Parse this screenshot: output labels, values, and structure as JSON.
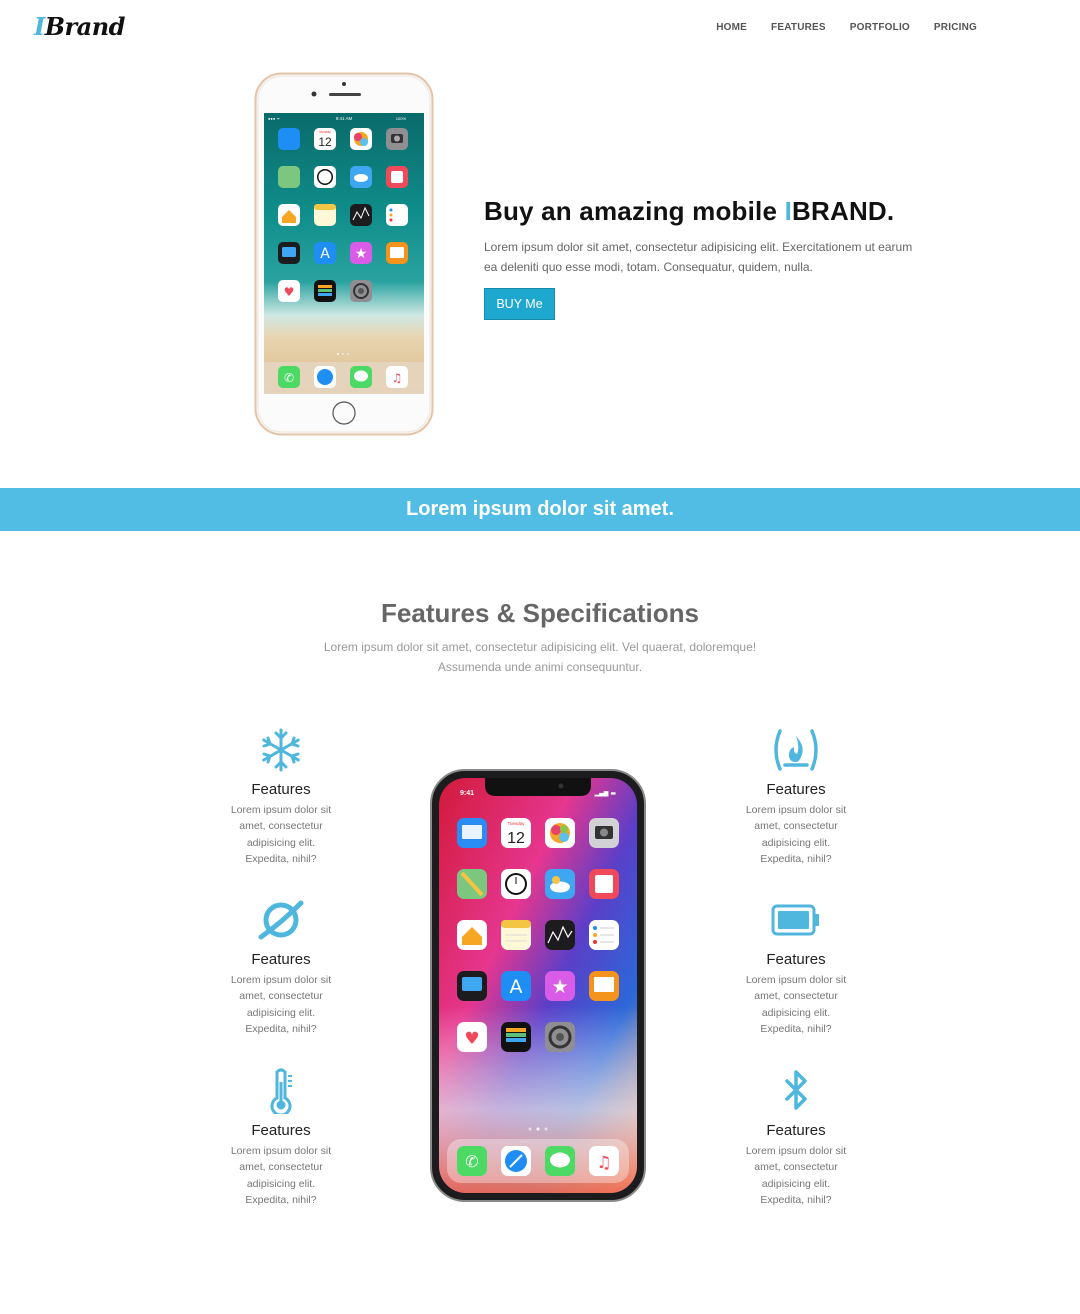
{
  "brand": {
    "prefix": "I",
    "name": "Brand"
  },
  "nav": {
    "items": [
      {
        "label": "HOME"
      },
      {
        "label": "FEATURES"
      },
      {
        "label": "PORTFOLIO"
      },
      {
        "label": "PRICING"
      }
    ]
  },
  "hero": {
    "title_before": "Buy an amazing mobile ",
    "title_accent": "I",
    "title_after": "BRAND.",
    "description": "Lorem ipsum dolor sit amet, consectetur adipisicing elit. Exercitationem ut earum ea deleniti quo esse modi, totam. Consequatur, quidem, nulla.",
    "button_label": "BUY Me",
    "phone": {
      "status_time": "9:41 AM",
      "status_battery": "100%",
      "calendar_day": "Monday",
      "calendar_date": "12"
    }
  },
  "banner": {
    "text": "Lorem ipsum dolor sit amet."
  },
  "features_section": {
    "title": "Features & Specifications",
    "subtitle": "Lorem ipsum dolor sit amet, consectetur adipisicing elit. Vel quaerat, doloremque! Assumenda unde animi consequuntur.",
    "left": [
      {
        "icon": "snowflake-icon",
        "name": "Features",
        "desc": "Lorem ipsum dolor sit amet, consectetur adipisicing elit. Expedita, nihil?"
      },
      {
        "icon": "planet-ring-icon",
        "name": "Features",
        "desc": "Lorem ipsum dolor sit amet, consectetur adipisicing elit. Expedita, nihil?"
      },
      {
        "icon": "thermometer-icon",
        "name": "Features",
        "desc": "Lorem ipsum dolor sit amet, consectetur adipisicing elit. Expedita, nihil?"
      }
    ],
    "right": [
      {
        "icon": "fire-icon",
        "name": "Features",
        "desc": "Lorem ipsum dolor sit amet, consectetur adipisicing elit. Expedita, nihil?"
      },
      {
        "icon": "battery-full-icon",
        "name": "Features",
        "desc": "Lorem ipsum dolor sit amet, consectetur adipisicing elit. Expedita, nihil?"
      },
      {
        "icon": "bluetooth-icon",
        "name": "Features",
        "desc": "Lorem ipsum dolor sit amet, consectetur adipisicing elit. Expedita, nihil?"
      }
    ],
    "phone": {
      "status_time": "9:41",
      "calendar_day": "Tuesday",
      "calendar_date": "12"
    }
  },
  "colors": {
    "accent": "#52bde4",
    "button": "#1fa8cf",
    "icon": "#4fb6dd"
  }
}
